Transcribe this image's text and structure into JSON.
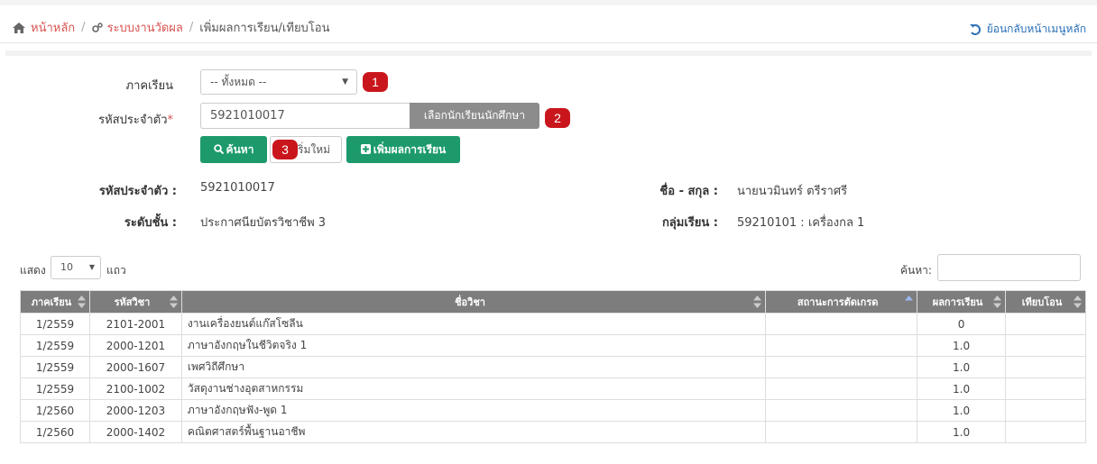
{
  "breadcrumb": {
    "home": "หน้าหลัก",
    "system": "ระบบงานวัดผล",
    "current": "เพิ่มผลการเรียน/เทียบโอน",
    "back": "ย้อนกลับหน้าเมนูหลัก"
  },
  "form": {
    "semester_label": "ภาคเรียน",
    "semester_value": "-- ทั้งหมด --",
    "student_id_label": "รหัสประจำตัว",
    "required_mark": "*",
    "student_id_value": "5921010017",
    "pick_student_button": "เลือกนักเรียนนักศึกษา",
    "search_button": "ค้นหา",
    "reset_button": "เริ่มใหม่",
    "add_grade_button": "เพิ่มผลการเรียน"
  },
  "badges": [
    "1",
    "2",
    "3"
  ],
  "student_info": {
    "id_label": "รหัสประจำตัว :",
    "id_value": "5921010017",
    "name_label": "ชื่อ - สกุล :",
    "name_value": "นายนวมินทร์ ตรีราศรี",
    "level_label": "ระดับชั้น :",
    "level_value": "ประกาศนียบัตรวิชาชีพ 3",
    "group_label": "กลุ่มเรียน :",
    "group_value": "59210101 : เครื่องกล 1"
  },
  "table_controls": {
    "show_label": "แสดง",
    "page_length": "10",
    "rows_label": "แถว",
    "search_label": "ค้นหา:"
  },
  "table": {
    "columns": [
      "ภาคเรียน",
      "รหัสวิชา",
      "ชื่อวิชา",
      "สถานะการตัดเกรด",
      "ผลการเรียน",
      "เทียบโอน"
    ],
    "rows": [
      {
        "semester": "1/2559",
        "code": "2101-2001",
        "name": "งานเครื่องยนต์แก๊สโซลีน",
        "status": "",
        "grade": "0",
        "transfer": ""
      },
      {
        "semester": "1/2559",
        "code": "2000-1201",
        "name": "ภาษาอังกฤษในชีวิตจริง 1",
        "status": "",
        "grade": "1.0",
        "transfer": ""
      },
      {
        "semester": "1/2559",
        "code": "2000-1607",
        "name": "เพศวิถีศึกษา",
        "status": "",
        "grade": "1.0",
        "transfer": ""
      },
      {
        "semester": "1/2559",
        "code": "2100-1002",
        "name": "วัสดุงานช่างอุตสาหกรรม",
        "status": "",
        "grade": "1.0",
        "transfer": ""
      },
      {
        "semester": "1/2560",
        "code": "2000-1203",
        "name": "ภาษาอังกฤษฟัง-พูด 1",
        "status": "",
        "grade": "1.0",
        "transfer": ""
      },
      {
        "semester": "1/2560",
        "code": "2000-1402",
        "name": "คณิตศาสตร์พื้นฐานอาชีพ",
        "status": "",
        "grade": "1.0",
        "transfer": ""
      }
    ]
  },
  "colors": {
    "accent_link": "#d9534f",
    "green_button": "#1c9a6c",
    "badge_red": "#c9161c",
    "table_header": "#7d7d7d"
  }
}
